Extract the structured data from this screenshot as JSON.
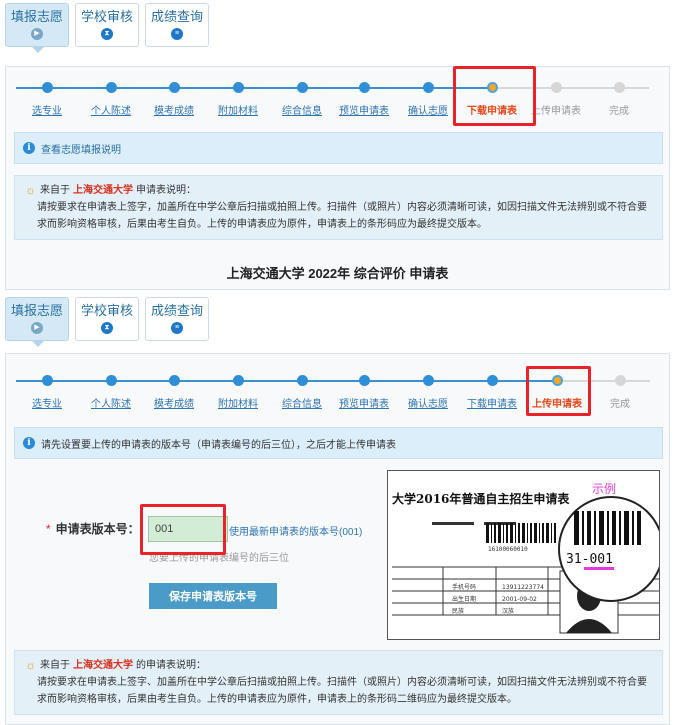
{
  "tabs": [
    {
      "label": "填报志愿",
      "icon": "play-icon"
    },
    {
      "label": "学校审核",
      "icon": "hourglass-icon"
    },
    {
      "label": "成绩查询",
      "icon": "list-icon"
    }
  ],
  "steps": [
    {
      "label": "选专业"
    },
    {
      "label": "个人陈述"
    },
    {
      "label": "模考成绩"
    },
    {
      "label": "附加材料"
    },
    {
      "label": "综合信息"
    },
    {
      "label": "预览申请表"
    },
    {
      "label": "确认志愿"
    },
    {
      "label": "下载申请表"
    },
    {
      "label": "上传申请表"
    },
    {
      "label": "完成"
    }
  ],
  "section1": {
    "current_step": 7,
    "info_link": "查看志愿填报说明",
    "notice": {
      "prefix": "来自于",
      "school": "上海交通大学",
      "suffix": "申请表说明：",
      "body": "请按要求在申请表上签字，加盖所在中学公章后扫描或拍照上传。扫描件（或照片）内容必须清晰可读，如因扫描文件无法辨别或不符合要求而影响资格审核，后果由考生自负。上传的申请表应为原件，申请表上的条形码应为最终提交版本。"
    },
    "form_title": "上海交通大学 2022年 综合评价 申请表"
  },
  "section2": {
    "current_step": 8,
    "info_text": "请先设置要上传的申请表的版本号（申请表编号的后三位），之后才能上传申请表",
    "required_mark": "*",
    "version_label": "申请表版本号：",
    "version_value": "001",
    "latest_link": "使用最新申请表的版本号(001)",
    "hint": "您要上传的申请表编号的后三位",
    "save_button": "保存申请表版本号",
    "sample": {
      "title": "大学2016年普通自主招生申请表",
      "tag": "示例",
      "code": "31-001",
      "barcode_number": "16100060010",
      "table_labels": [
        "手机号码",
        "13911223774",
        "出生日期",
        "2001-09-02",
        "民族",
        "汉族"
      ]
    },
    "notice": {
      "prefix": "来自于",
      "school": "上海交通大学",
      "suffix": "的申请表说明：",
      "body": "请按要求在申请表上签字、加盖所在中学公章后扫描或拍照上传。扫描件（或照片）内容必须清晰可读，如因扫描文件无法辨别或不符合要求而影响资格审核，后果由考生自负。上传的申请表应为原件，申请表上的条形码二维码应为最终提交版本。"
    }
  },
  "colors": {
    "accent": "#2f8ed6",
    "current": "#e64a1b",
    "highlight": "#e8232a",
    "school": "#d8301f"
  }
}
